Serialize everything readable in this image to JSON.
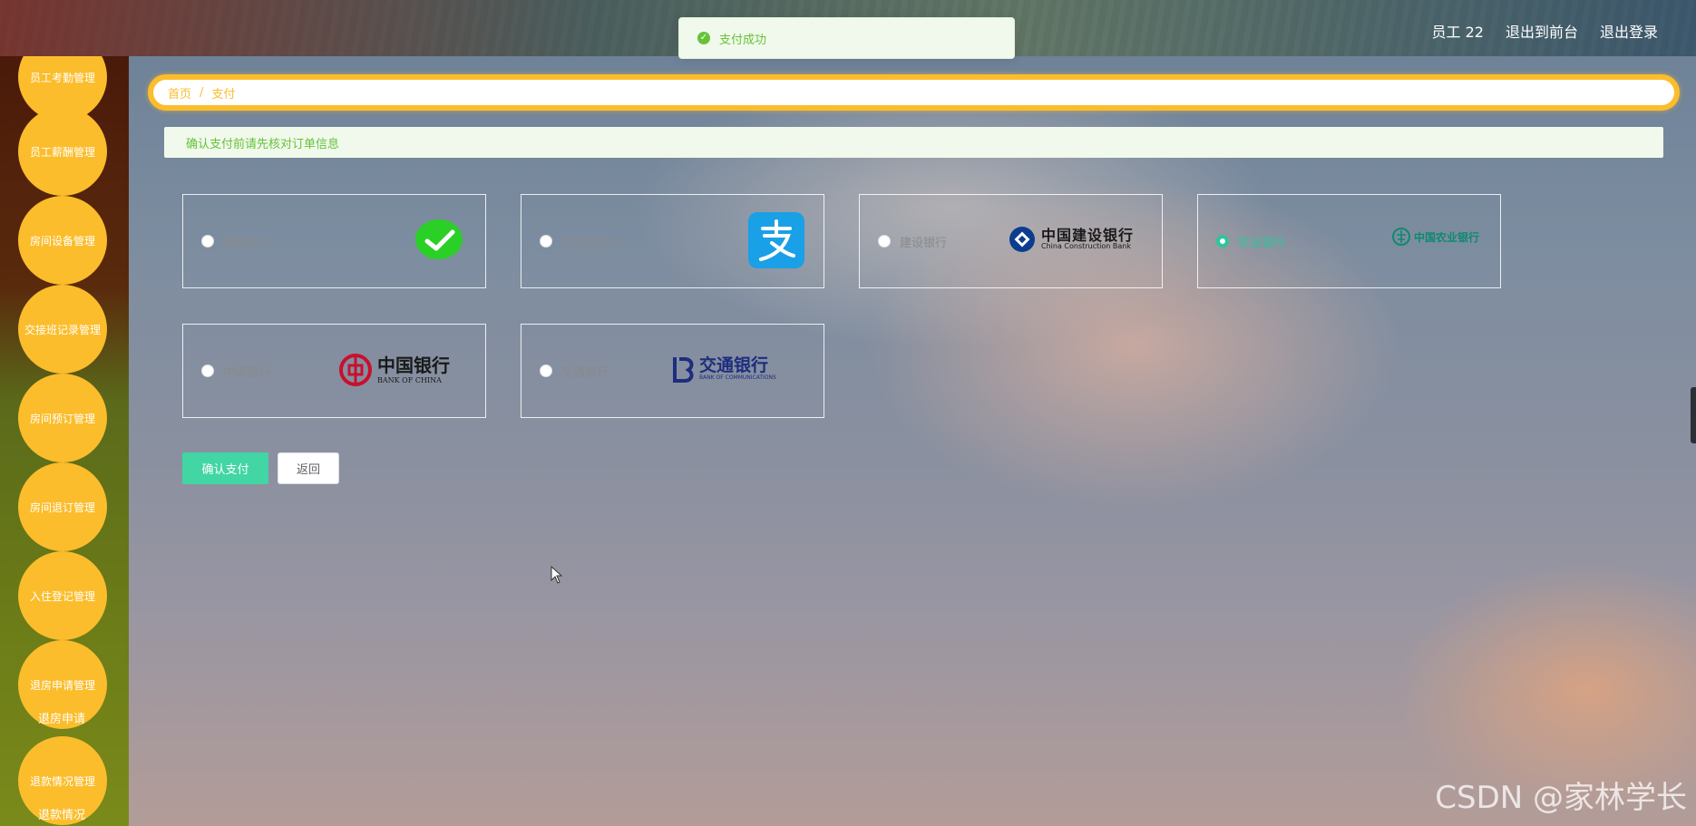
{
  "header": {
    "user": "员工 22",
    "to_front": "退出到前台",
    "logout": "退出登录"
  },
  "toast": {
    "message": "支付成功"
  },
  "sidebar": {
    "items": [
      "员工考勤管理",
      "员工薪酬管理",
      "房间设备管理",
      "交接班记录管理",
      "房间预订管理",
      "房间退订管理",
      "入住登记管理",
      "退房申请管理",
      "退款情况管理"
    ],
    "subs": [
      "退房申请",
      "退款情况"
    ]
  },
  "breadcrumb": {
    "home": "首页",
    "sep": "/",
    "current": "支付"
  },
  "notice": "确认支付前请先核对订单信息",
  "payments": [
    {
      "label": "微信支付",
      "icon": "wechat-icon",
      "color": "#2ad026"
    },
    {
      "label": "支付宝支付",
      "icon": "alipay-icon",
      "color": "#1aa0e6"
    },
    {
      "label": "建设银行",
      "icon": "ccb-logo",
      "logo_text": "中国建设银行",
      "logo_sub": "China Construction Bank",
      "color": "#0a3d8f"
    },
    {
      "label": "农业银行",
      "icon": "abc-logo",
      "logo_text": "中国农业银行",
      "color": "#0e8a6e",
      "selected": true
    },
    {
      "label": "中国银行",
      "icon": "boc-logo",
      "logo_text": "中国银行",
      "logo_sub": "BANK OF CHINA",
      "color": "#c8102e"
    },
    {
      "label": "交通银行",
      "icon": "bocom-logo",
      "logo_text": "交通银行",
      "logo_sub": "BANK OF COMMUNICATIONS",
      "color": "#1e2d7d"
    }
  ],
  "buttons": {
    "confirm": "确认支付",
    "back": "返回"
  },
  "watermark": "CSDN @家林学长"
}
